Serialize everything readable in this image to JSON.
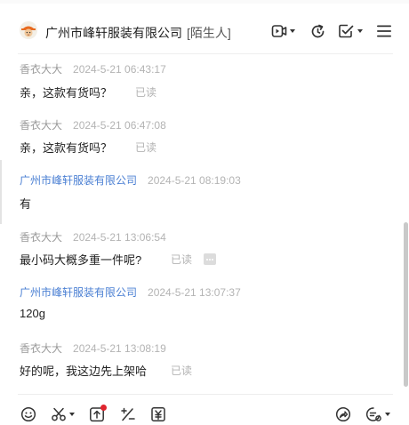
{
  "header": {
    "shop_name": "广州市峰轩服装有限公司",
    "tag": "[陌生人]",
    "icons": [
      "video-call-icon",
      "history-icon",
      "task-check-icon",
      "menu-icon"
    ]
  },
  "messages": [
    {
      "sender": "香衣大大",
      "time": "2024-5-21 06:43:17",
      "text": "亲，这款有货吗？",
      "read": "已读",
      "from_shop": false
    },
    {
      "sender": "香衣大大",
      "time": "2024-5-21 06:47:08",
      "text": "亲，这款有货吗？",
      "read": "已读",
      "from_shop": false
    },
    {
      "sender": "广州市峰轩服装有限公司",
      "time": "2024-5-21 08:19:03",
      "text": "有",
      "read": "",
      "from_shop": true
    },
    {
      "sender": "香衣大大",
      "time": "2024-5-21 13:06:54",
      "text": "最小码大概多重一件呢?",
      "read": "已读",
      "from_shop": false
    },
    {
      "sender": "广州市峰轩服装有限公司",
      "time": "2024-5-21 13:07:37",
      "text": "120g",
      "read": "",
      "from_shop": true
    },
    {
      "sender": "香衣大大",
      "time": "2024-5-21 13:08:19",
      "text": "好的呢，我这边先上架哈",
      "read": "已读",
      "from_shop": false
    }
  ],
  "footer": {
    "icons": [
      "emoji-icon",
      "scissors-icon",
      "upload-icon",
      "quick-reply-icon",
      "coupon-icon",
      "share-icon",
      "settings-menu-icon"
    ]
  },
  "colors": {
    "shop_name_link": "#4a7fd3",
    "unread_dot": "#e0242e",
    "muted_text": "#b3b3b3"
  }
}
